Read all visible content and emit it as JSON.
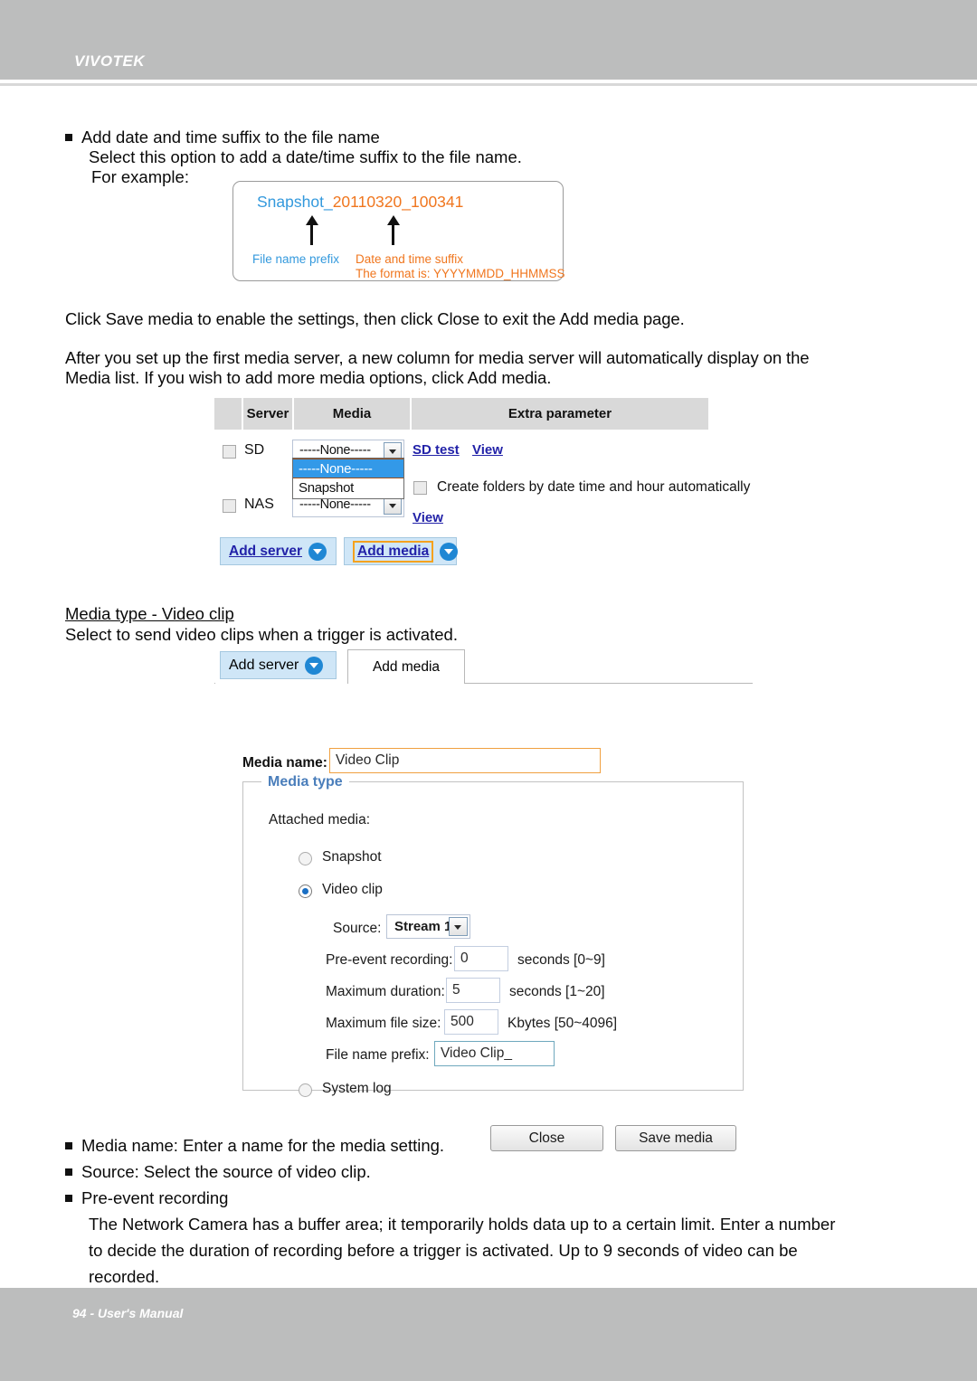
{
  "header": {
    "brand": "VIVOTEK"
  },
  "footer": {
    "text": "94 - User's Manual"
  },
  "doc": {
    "bullet_add_suffix": "Add date and time suffix to the file name",
    "line_select_option": "Select this option to add a date/time suffix to the file name.",
    "line_for_example": "For example:",
    "para_click_save": "Click Save media to enable the settings, then click  Close to exit the Add media page.",
    "para_after_setup_1": "After you set up the first media server, a new column for media server will automatically display on the",
    "para_after_setup_2": "Media list. If you wish to add more media options, click Add media.",
    "heading_media_type_video": "Media type - Video clip",
    "line_select_to_send": "Select to send video clips when a trigger is activated.",
    "bullet_media_name": "Media name: Enter a name for the media setting.",
    "bullet_source": "Source: Select the source of video clip.",
    "bullet_pre_event": "Pre-event recording",
    "para_buffer_1": "The Network Camera has a buffer area; it temporarily holds data up to a certain limit. Enter a number",
    "para_buffer_2": "to decide the duration of recording before a trigger is activated. Up to 9 seconds of video can be",
    "para_buffer_3": "recorded."
  },
  "snapshot_example": {
    "prefix": "Snapshot_",
    "suffix": "20110320_100341",
    "label_prefix": "File name prefix",
    "label_suffix": "Date and time suffix",
    "label_format": "The format is: YYYYMMDD_HHMMSS",
    "color_prefix": "#3399dd",
    "color_suffix": "#f0761e"
  },
  "media_list": {
    "columns": [
      "",
      "Server",
      "Media",
      "Extra parameter"
    ],
    "rows": [
      {
        "server": "SD",
        "media_value": "-----None-----",
        "checked": false
      },
      {
        "server": "NAS",
        "media_value": "-----None-----",
        "checked": false
      }
    ],
    "dropdown_open": {
      "options": [
        "-----None-----",
        "Snapshot"
      ],
      "selected": "-----None-----"
    },
    "links": {
      "sd_test": "SD test",
      "view_1": "View",
      "view_2": "View"
    },
    "create_folders_label": "Create folders by date time and hour automatically",
    "buttons": {
      "add_server": "Add server",
      "add_media": "Add media"
    }
  },
  "form_panel": {
    "tabs": {
      "add_server": "Add server",
      "add_media": "Add media"
    },
    "media_name_label": "Media name:",
    "media_name_value": "Video Clip",
    "fieldset_legend": "Media type",
    "attached_media_label": "Attached media:",
    "radios": {
      "snapshot": "Snapshot",
      "video_clip": "Video clip",
      "system_log": "System log",
      "selected": "Video clip"
    },
    "source_label": "Source:",
    "source_value": "Stream 1",
    "pre_event_label": "Pre-event recording:",
    "pre_event_value": "0",
    "pre_event_unit": "seconds [0~9]",
    "max_duration_label": "Maximum duration:",
    "max_duration_value": "5",
    "max_duration_unit": "seconds [1~20]",
    "max_file_size_label": "Maximum file size:",
    "max_file_size_value": "500",
    "max_file_size_unit": "Kbytes [50~4096]",
    "file_prefix_label": "File name prefix:",
    "file_prefix_value": "Video Clip_",
    "close_button": "Close",
    "save_button": "Save media"
  }
}
